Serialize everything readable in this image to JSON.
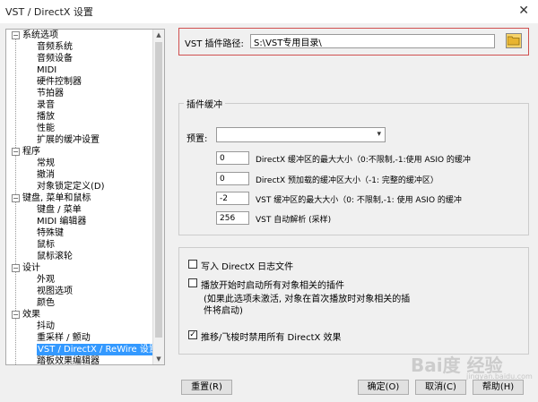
{
  "window": {
    "title": "VST / DirectX 设置",
    "close_glyph": "✕"
  },
  "tree": {
    "items": [
      {
        "label": "系统选项",
        "level": 0,
        "expander": "−"
      },
      {
        "label": "音频系统",
        "level": 1
      },
      {
        "label": "音频设备",
        "level": 1
      },
      {
        "label": "MIDI",
        "level": 1
      },
      {
        "label": "硬件控制器",
        "level": 1
      },
      {
        "label": "节拍器",
        "level": 1
      },
      {
        "label": "录音",
        "level": 1
      },
      {
        "label": "播放",
        "level": 1
      },
      {
        "label": "性能",
        "level": 1
      },
      {
        "label": "扩展的缓冲设置",
        "level": 1
      },
      {
        "label": "程序",
        "level": 0,
        "expander": "−"
      },
      {
        "label": "常规",
        "level": 1
      },
      {
        "label": "撤消",
        "level": 1
      },
      {
        "label": "对象锁定定义(D)",
        "level": 1
      },
      {
        "label": "键盘, 菜单和鼠标",
        "level": 0,
        "expander": "−"
      },
      {
        "label": "键盘 / 菜单",
        "level": 1
      },
      {
        "label": "MIDI 编辑器",
        "level": 1
      },
      {
        "label": "特殊键",
        "level": 1
      },
      {
        "label": "鼠标",
        "level": 1
      },
      {
        "label": "鼠标滚轮",
        "level": 1
      },
      {
        "label": "设计",
        "level": 0,
        "expander": "−"
      },
      {
        "label": "外观",
        "level": 1
      },
      {
        "label": "视图选项",
        "level": 1
      },
      {
        "label": "颜色",
        "level": 1
      },
      {
        "label": "效果",
        "level": 0,
        "expander": "−"
      },
      {
        "label": "抖动",
        "level": 1
      },
      {
        "label": "重采样 / 颤动",
        "level": 1
      },
      {
        "label": "VST / DirectX / ReWire 设置",
        "level": 1,
        "selected": true
      },
      {
        "label": "踏板效果编辑器",
        "level": 1
      }
    ]
  },
  "vst": {
    "label": "VST 插件路径:",
    "value": "S:\\VST专用目录\\"
  },
  "buffer": {
    "title": "插件缓冲",
    "preset_label": "预置:",
    "preset_value": "",
    "rows": [
      {
        "value": "0",
        "label": "DirectX 缓冲区的最大大小（0:不限制,-1:使用 ASIO 的缓冲"
      },
      {
        "value": "0",
        "label": "DirectX 预加载的缓冲区大小（-1: 完整的缓冲区）"
      },
      {
        "value": "-2",
        "label": "VST 缓冲区的最大大小（0: 不限制,-1: 使用 ASIO 的缓冲"
      },
      {
        "value": "256",
        "label": "VST 自动解析 (采样)"
      }
    ]
  },
  "options": {
    "write_log": {
      "label": "写入 DirectX 日志文件",
      "checked": false
    },
    "start_all": {
      "label": "播放开始时启动所有对象相关的插件",
      "checked": false
    },
    "note": "(如果此选项未激活, 对象在首次播放时对象相关的插件将启动)",
    "disable_fx": {
      "label": "推移/飞梭时禁用所有 DirectX 效果",
      "checked": true
    }
  },
  "buttons": {
    "reset": "重置(R)",
    "ok": "确定(O)",
    "cancel": "取消(C)",
    "help": "帮助(H)"
  },
  "watermark": {
    "main": "Bai度 经验",
    "sub": "jingyan.baidu.com"
  },
  "icons": {
    "folder": "folder-icon",
    "check": "✓",
    "dropdown": "▾"
  }
}
